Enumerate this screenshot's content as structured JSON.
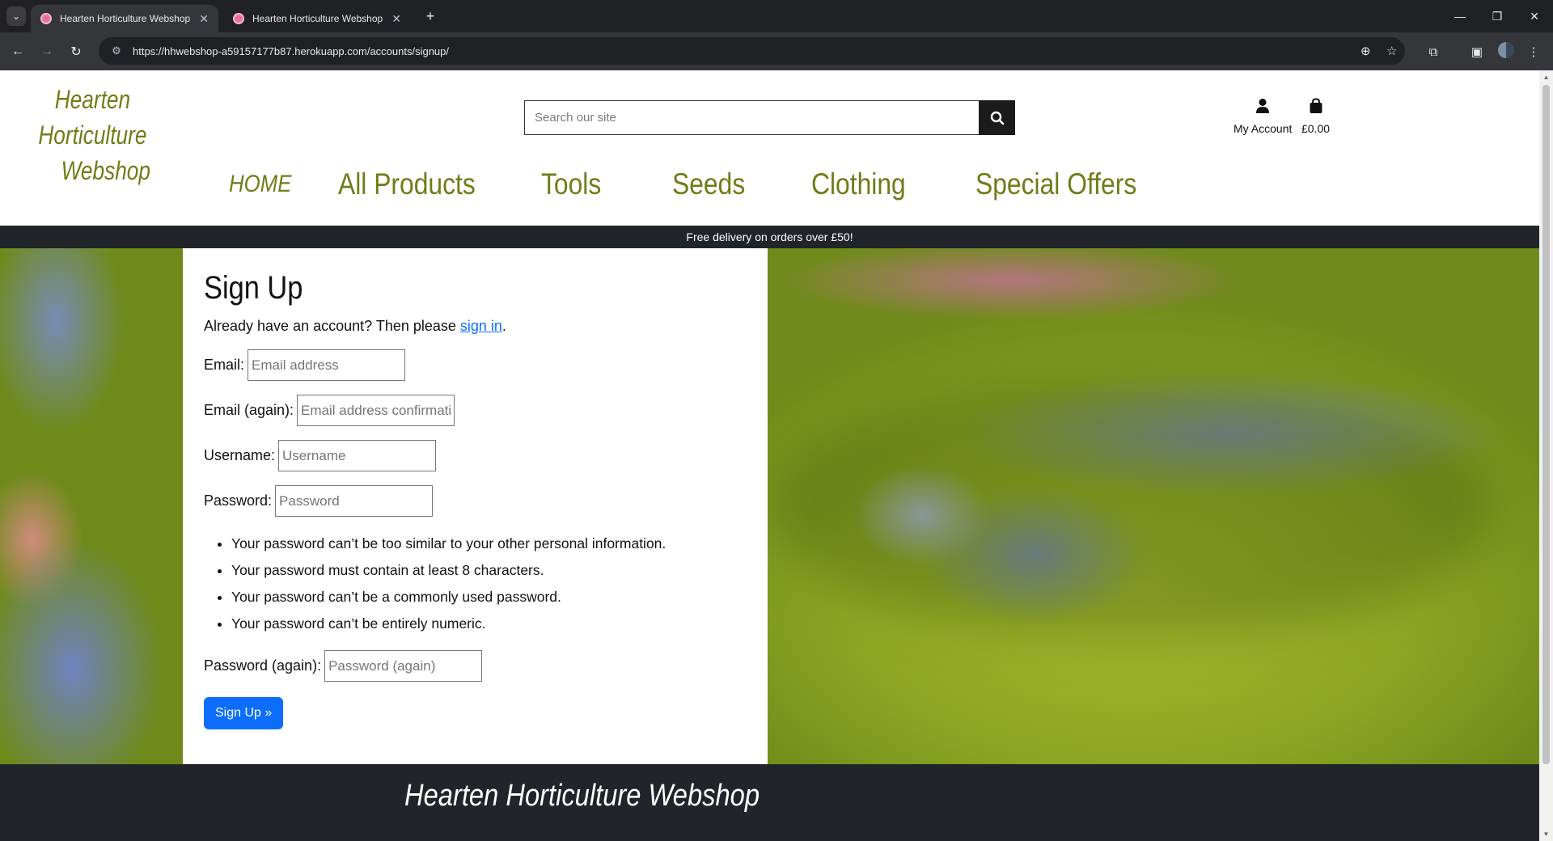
{
  "browser": {
    "tabs": [
      {
        "title": "Hearten Horticulture Webshop",
        "active": true
      },
      {
        "title": "Hearten Horticulture Webshop",
        "active": false
      }
    ],
    "url": "https://hhwebshop-a59157177b87.herokuapp.com/accounts/signup/"
  },
  "header": {
    "logo_line1": "Hearten Horticulture",
    "logo_line2": "Webshop",
    "search_placeholder": "Search our site",
    "account_label": "My Account",
    "cart_total": "£0.00"
  },
  "nav": {
    "items": [
      "HOME",
      "All Products",
      "Tools",
      "Seeds",
      "Clothing",
      "Special Offers"
    ]
  },
  "banner": {
    "text": "Free delivery on orders over £50!"
  },
  "signup": {
    "title": "Sign Up",
    "intro_prefix": "Already have an account? Then please ",
    "intro_link": "sign in",
    "intro_suffix": ".",
    "fields": [
      {
        "label": "Email:",
        "placeholder": "Email address"
      },
      {
        "label": "Email (again):",
        "placeholder": "Email address confirmation"
      },
      {
        "label": "Username:",
        "placeholder": "Username"
      },
      {
        "label": "Password:",
        "placeholder": "Password"
      }
    ],
    "password_rules": [
      "Your password can’t be too similar to your other personal information.",
      "Your password must contain at least 8 characters.",
      "Your password can’t be a commonly used password.",
      "Your password can’t be entirely numeric."
    ],
    "password_again_label": "Password (again):",
    "password_again_placeholder": "Password (again)",
    "submit_label": "Sign Up »"
  },
  "footer": {
    "logo_bold": "Hearten Horticulture",
    "logo_light": "Webshop"
  },
  "icons": {
    "tab_favicon": "flower-icon",
    "search": "search-icon",
    "account": "user-icon",
    "cart": "shopping-bag-icon"
  },
  "colors": {
    "brand_green": "#6e7d17",
    "dark": "#212529",
    "primary_button": "#0d6efd"
  }
}
